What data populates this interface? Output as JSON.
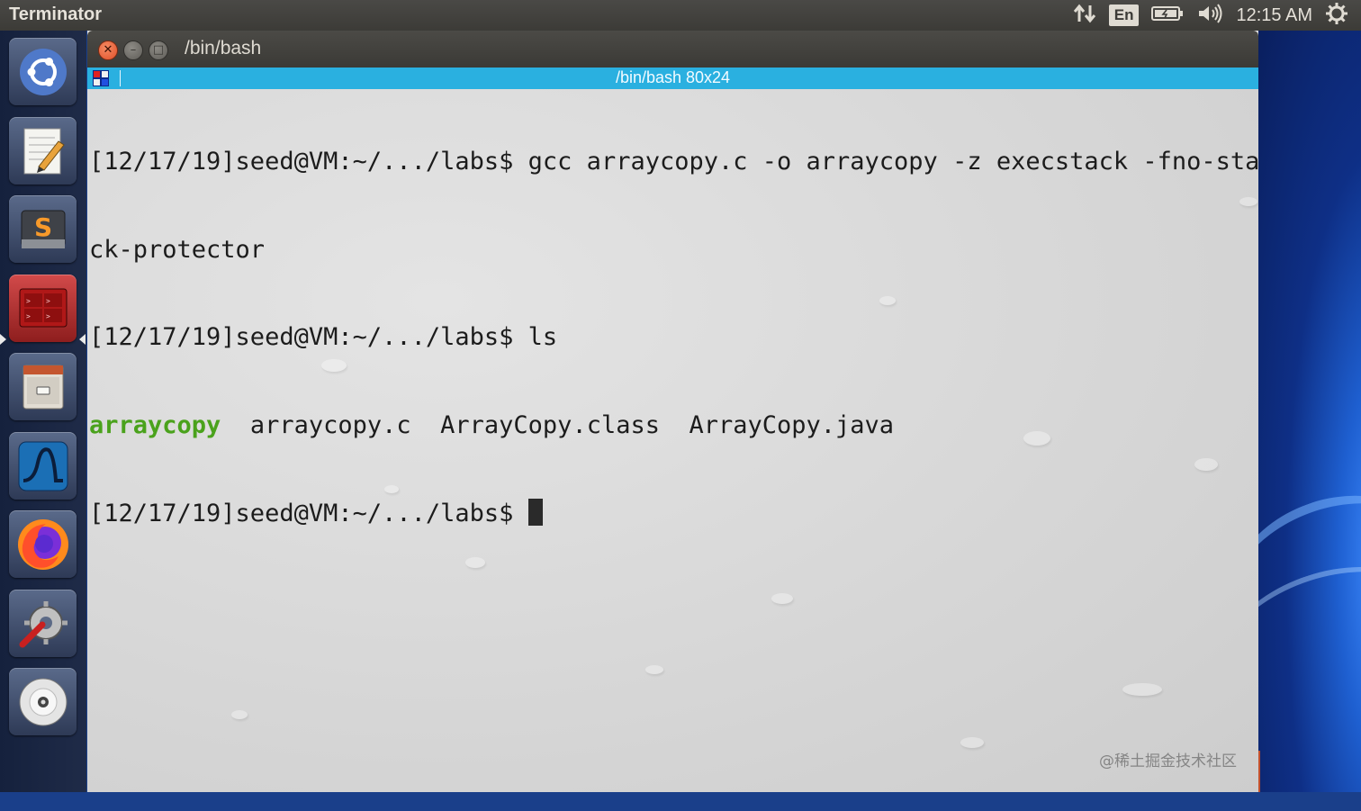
{
  "top_panel": {
    "app_title": "Terminator",
    "language": "En",
    "clock": "12:15 AM"
  },
  "launcher": {
    "items": [
      {
        "name": "ubuntu-dash-icon"
      },
      {
        "name": "text-editor-icon"
      },
      {
        "name": "sublime-text-icon"
      },
      {
        "name": "terminator-icon",
        "active": true
      },
      {
        "name": "file-manager-icon"
      },
      {
        "name": "wireshark-icon"
      },
      {
        "name": "firefox-icon"
      },
      {
        "name": "system-settings-icon"
      },
      {
        "name": "dvd-icon"
      }
    ]
  },
  "window": {
    "title": "/bin/bash",
    "tab_title": "/bin/bash 80x24"
  },
  "terminal": {
    "line1": "[12/17/19]seed@VM:~/.../labs$ gcc arraycopy.c -o arraycopy -z execstack -fno-sta",
    "line2": "ck-protector",
    "line3": "[12/17/19]seed@VM:~/.../labs$ ls",
    "ls_executable": "arraycopy",
    "ls_rest": "  arraycopy.c  ArrayCopy.class  ArrayCopy.java",
    "prompt": "[12/17/19]seed@VM:~/.../labs$ "
  },
  "watermark": "@稀土掘金技术社区",
  "colors": {
    "tab_bar": "#2ab0e0",
    "executable_text": "#4aa21c",
    "panel": "#3c3b37"
  }
}
